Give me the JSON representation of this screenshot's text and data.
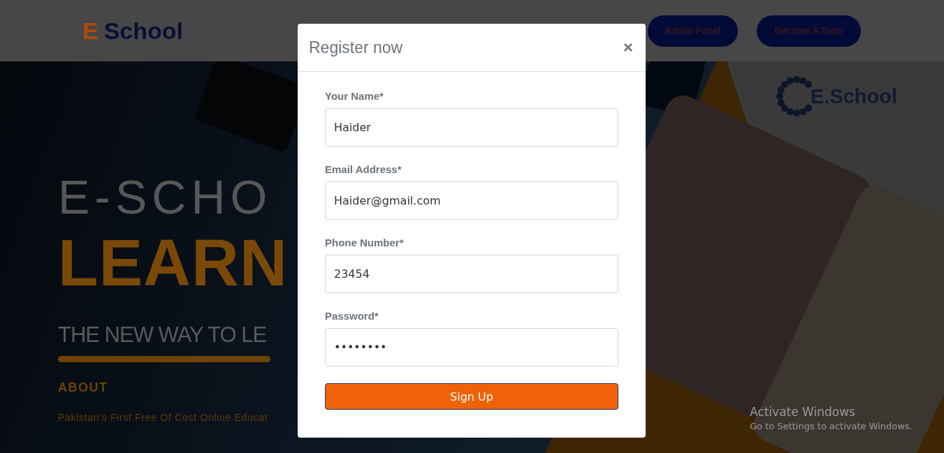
{
  "header": {
    "logo": {
      "accent": "E",
      "text": "School"
    },
    "buttons": [
      "Admin Panel",
      "Become A Tutor"
    ]
  },
  "banner": {
    "headline": "E-SCHO",
    "title": "LEARN",
    "tagline": "THE NEW WAY TO LE",
    "section_label": "ABOUT",
    "description": "Pakistan's First Free Of Cost Online Educat",
    "logo": "E.School"
  },
  "modal": {
    "title": "Register now",
    "close": "×",
    "fields": [
      {
        "label": "Your Name*",
        "value": "Haider"
      },
      {
        "label": "Email Address*",
        "value": "Haider@gmail.com"
      },
      {
        "label": "Phone Number*",
        "value": "23454"
      },
      {
        "label": "Password*",
        "value": "••••••••"
      }
    ],
    "submit": "Sign Up"
  },
  "os_notice": {
    "title": "Activate Windows",
    "text": "Go to Settings to activate Windows."
  }
}
